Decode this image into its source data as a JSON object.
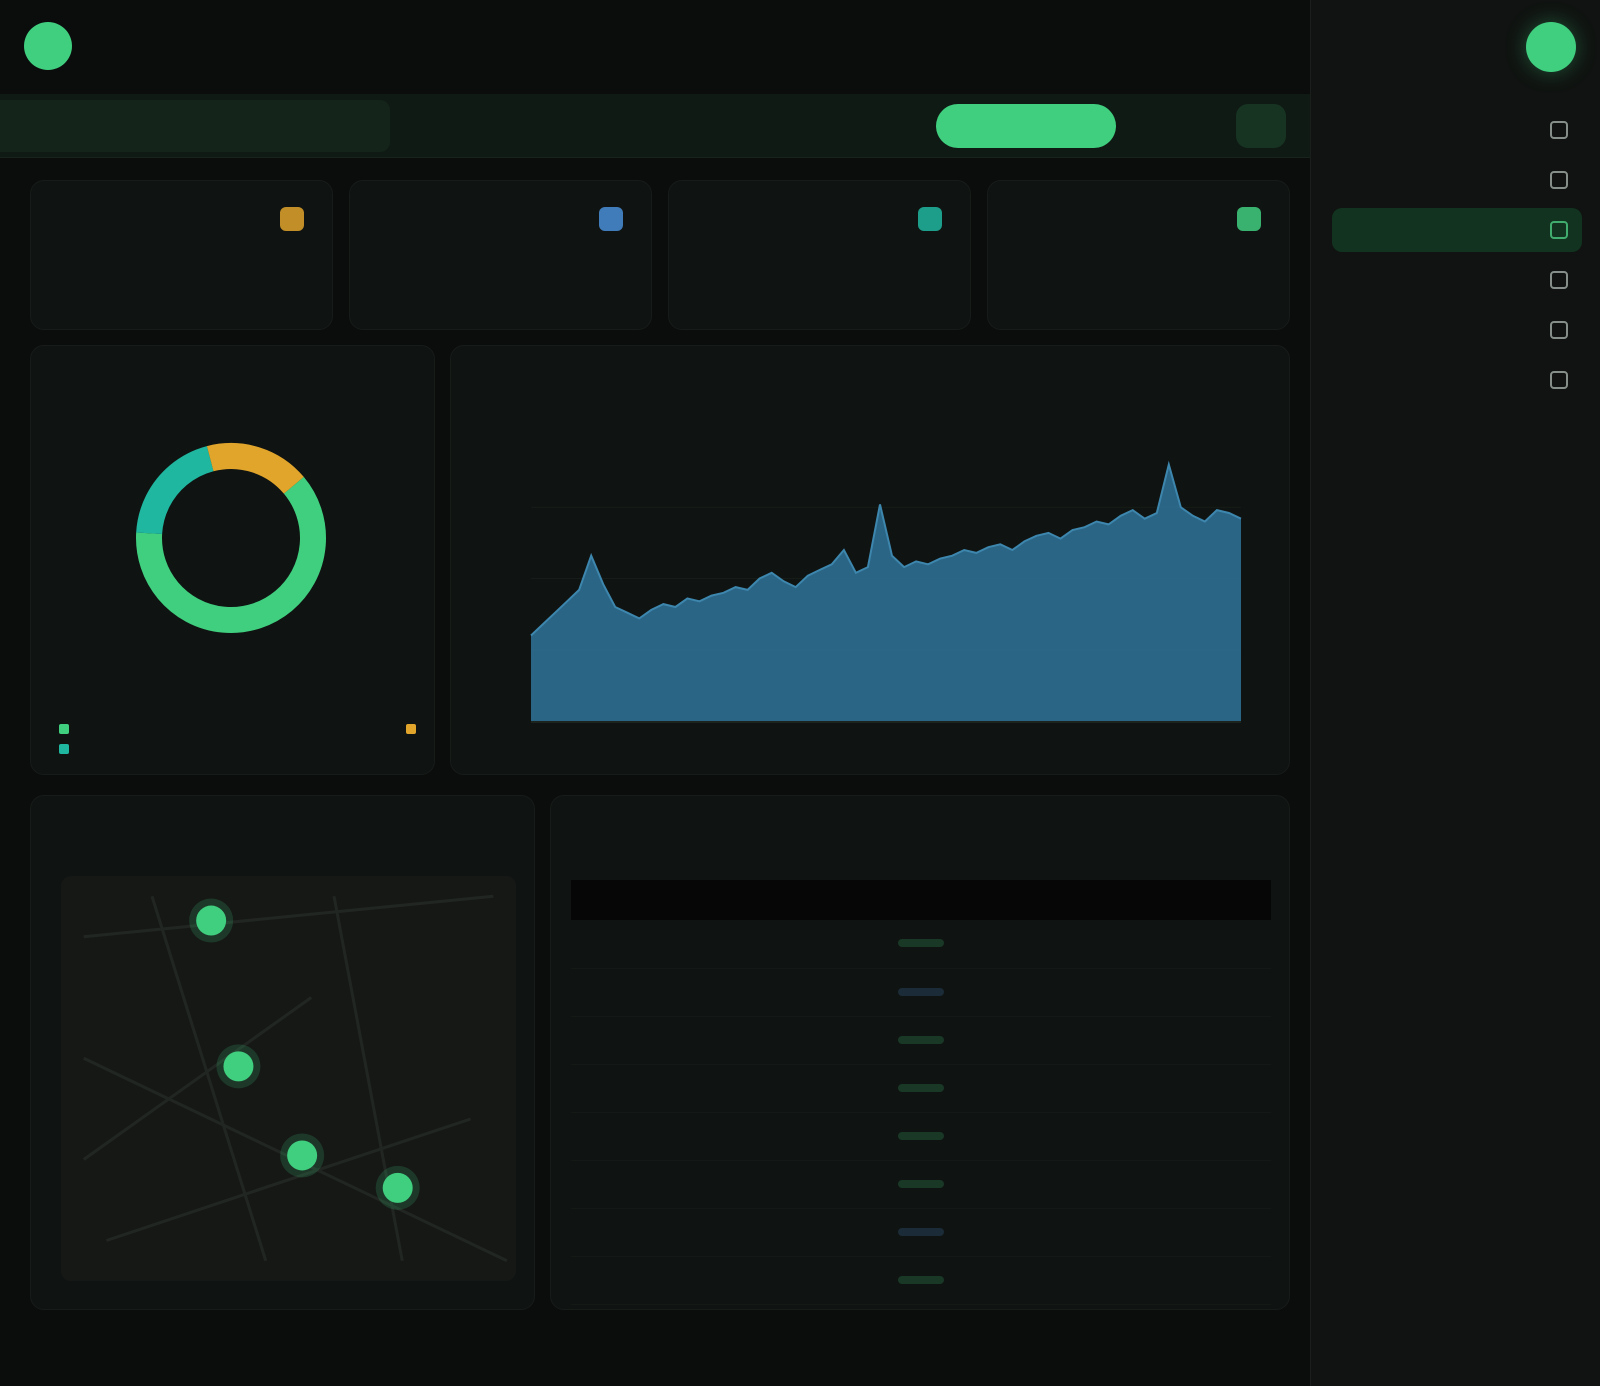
{
  "colors": {
    "accent": "#3fcf7f",
    "blue": "#2f6f93",
    "teal": "#1fb7a0",
    "amber": "#e2a52b",
    "sky": "#4a8fd8"
  },
  "sidebar": {
    "brand": "",
    "items": [
      {
        "label": "",
        "icon": "dashboard-icon",
        "active": false
      },
      {
        "label": "",
        "icon": "chart-icon",
        "active": false
      },
      {
        "label": "",
        "icon": "layers-icon",
        "active": true
      },
      {
        "label": "",
        "icon": "users-icon",
        "active": false
      },
      {
        "label": "",
        "icon": "file-icon",
        "active": false
      },
      {
        "label": "",
        "icon": "settings-icon",
        "active": false
      }
    ]
  },
  "header": {
    "title": ""
  },
  "search": {
    "placeholder": ""
  },
  "tabs": [
    {
      "label": "",
      "active": false,
      "first": true
    },
    {
      "label": "",
      "active": false
    },
    {
      "label": "",
      "active": false
    },
    {
      "label": "",
      "active": true
    },
    {
      "label": "",
      "active": false
    },
    {
      "label": "",
      "active": false
    },
    {
      "label": "",
      "active": false
    }
  ],
  "stats": [
    {
      "value": "",
      "label": "",
      "color": "#3fcf7f"
    },
    {
      "value": "",
      "label": "",
      "color": "#1fb7a0"
    },
    {
      "value": "",
      "label": "",
      "color": "#4a8fd8"
    },
    {
      "value": "",
      "label": "",
      "color": "#e2a52b"
    }
  ],
  "donut": {
    "title": "",
    "subtitle": "",
    "center": "",
    "segments": [
      {
        "label": "",
        "value": 62,
        "color": "#3fcf7f"
      },
      {
        "label": "",
        "value": 20,
        "color": "#1fb7a0"
      },
      {
        "label": "",
        "value": 18,
        "color": "#e2a52b"
      }
    ]
  },
  "chart_data": {
    "type": "area",
    "title": "",
    "subtitle": "",
    "xlabel": "",
    "ylabel": "",
    "ylim": [
      0,
      100
    ],
    "x": [
      1,
      2,
      3,
      4,
      5,
      6,
      7,
      8,
      9,
      10,
      11,
      12,
      13,
      14,
      15,
      16,
      17,
      18,
      19,
      20,
      21,
      22,
      23,
      24,
      25,
      26,
      27,
      28,
      29,
      30,
      31,
      32,
      33,
      34,
      35,
      36,
      37,
      38,
      39,
      40,
      41,
      42,
      43,
      44,
      45,
      46,
      47,
      48,
      49,
      50,
      51,
      52,
      53,
      54,
      55,
      56,
      57,
      58,
      59,
      60
    ],
    "series": [
      {
        "name": "",
        "color": "#2f6f93",
        "values": [
          30,
          34,
          38,
          42,
          46,
          58,
          48,
          40,
          38,
          36,
          39,
          41,
          40,
          43,
          42,
          44,
          45,
          47,
          46,
          50,
          52,
          49,
          47,
          51,
          53,
          55,
          60,
          52,
          54,
          76,
          58,
          54,
          56,
          55,
          57,
          58,
          60,
          59,
          61,
          62,
          60,
          63,
          65,
          66,
          64,
          67,
          68,
          70,
          69,
          72,
          74,
          71,
          73,
          90,
          75,
          72,
          70,
          74,
          73,
          71
        ]
      }
    ]
  },
  "map": {
    "title": "",
    "points": [
      {
        "x": 0.33,
        "y": 0.11
      },
      {
        "x": 0.39,
        "y": 0.47
      },
      {
        "x": 0.53,
        "y": 0.69
      },
      {
        "x": 0.74,
        "y": 0.77
      }
    ]
  },
  "table": {
    "title": "",
    "subtitle": "",
    "headers": [
      "",
      "",
      "",
      ""
    ],
    "rows": [
      {
        "c1": "",
        "c2": "",
        "c3": "",
        "status": "",
        "tone": "green"
      },
      {
        "c1": "",
        "c2": "",
        "c3": "",
        "status": "",
        "tone": "blue"
      },
      {
        "c1": "",
        "c2": "",
        "c3": "",
        "status": "",
        "tone": "green"
      },
      {
        "c1": "",
        "c2": "",
        "c3": "",
        "status": "",
        "tone": "green"
      },
      {
        "c1": "",
        "c2": "",
        "c3": "",
        "status": "",
        "tone": "green"
      },
      {
        "c1": "",
        "c2": "",
        "c3": "",
        "status": "",
        "tone": "green"
      },
      {
        "c1": "",
        "c2": "",
        "c3": "",
        "status": "",
        "tone": "blue"
      },
      {
        "c1": "",
        "c2": "",
        "c3": "",
        "status": "",
        "tone": "green"
      }
    ]
  }
}
